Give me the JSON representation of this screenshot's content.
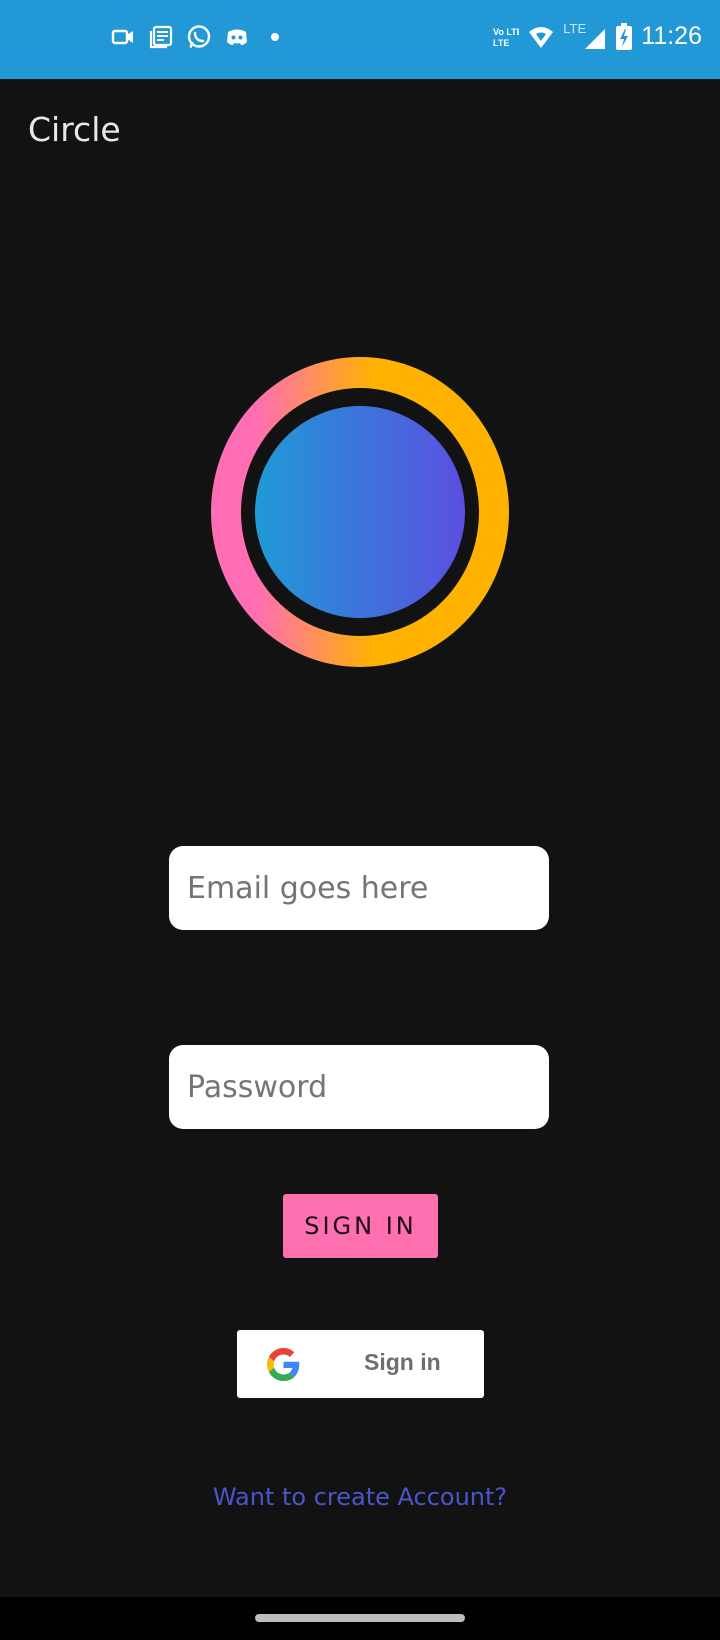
{
  "status_bar": {
    "time": "11:26",
    "left_icons": [
      "video-call-icon",
      "news-icon",
      "whatsapp-icon",
      "discord-icon",
      "dot-icon"
    ],
    "right_icons": [
      "volte-icon",
      "wifi-icon",
      "lte-signal-icon",
      "battery-charging-icon"
    ],
    "volte_label": "Vo LTE",
    "lte_label": "LTE"
  },
  "app": {
    "title": "Circle",
    "logo": {
      "ring_colors": [
        "#ff6eb4",
        "#ffb300"
      ],
      "core_colors": [
        "#1f9ad6",
        "#5b4fe0"
      ]
    }
  },
  "form": {
    "email_placeholder": "Email goes here",
    "password_placeholder": "Password",
    "signin_label": "SIGN IN",
    "google_signin_label": "Sign in",
    "create_account_link": "Want to create Account?"
  },
  "colors": {
    "status_bar": "#2299d6",
    "background": "#121212",
    "accent_pink": "#ff70b0",
    "link": "#4a55c8"
  }
}
